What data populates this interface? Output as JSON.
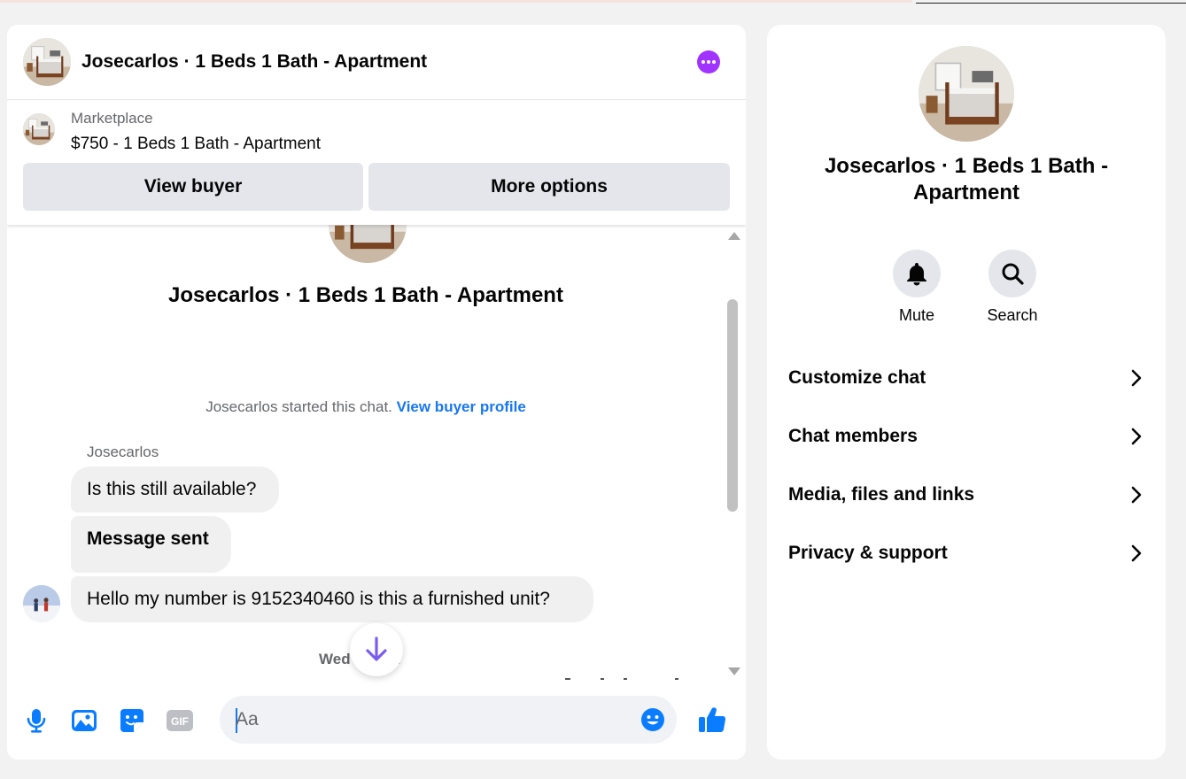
{
  "chat": {
    "title": "Josecarlos · 1 Beds 1 Bath - Apartment",
    "marketplace_label": "Marketplace",
    "listing": "$750 - 1 Beds 1 Bath - Apartment",
    "view_buyer_label": "View buyer",
    "more_options_label": "More options",
    "conversation_title": "Josecarlos · 1 Beds 1 Bath - Apartment",
    "started_text": "Josecarlos started this chat.",
    "started_link": "View buyer profile",
    "sender_name": "Josecarlos",
    "messages": [
      {
        "text": "Is this still available?"
      },
      {
        "text": "Message sent"
      },
      {
        "text": "Hello my number is 9152340460 is this a furnished unit?"
      }
    ],
    "timestamp": "Wed         M",
    "composer_placeholder": "Aa"
  },
  "info": {
    "title": "Josecarlos · 1 Beds 1 Bath - Apartment",
    "actions": [
      {
        "label": "Mute",
        "icon": "bell-icon"
      },
      {
        "label": "Search",
        "icon": "search-icon"
      }
    ],
    "menu": [
      {
        "label": "Customize chat"
      },
      {
        "label": "Chat members"
      },
      {
        "label": "Media, files and links"
      },
      {
        "label": "Privacy & support"
      }
    ]
  },
  "icons": {
    "composer": [
      "microphone-icon",
      "image-icon",
      "sticker-icon",
      "gif-icon",
      "emoji-icon",
      "thumbs-up-icon"
    ],
    "scroll": "arrow-down-icon",
    "more": "more-dots-icon"
  },
  "colors": {
    "accent": "#0a7cff",
    "more_button": "#a033ff",
    "link": "#1877f2",
    "scroll_arrow": "#7b5cf0"
  }
}
